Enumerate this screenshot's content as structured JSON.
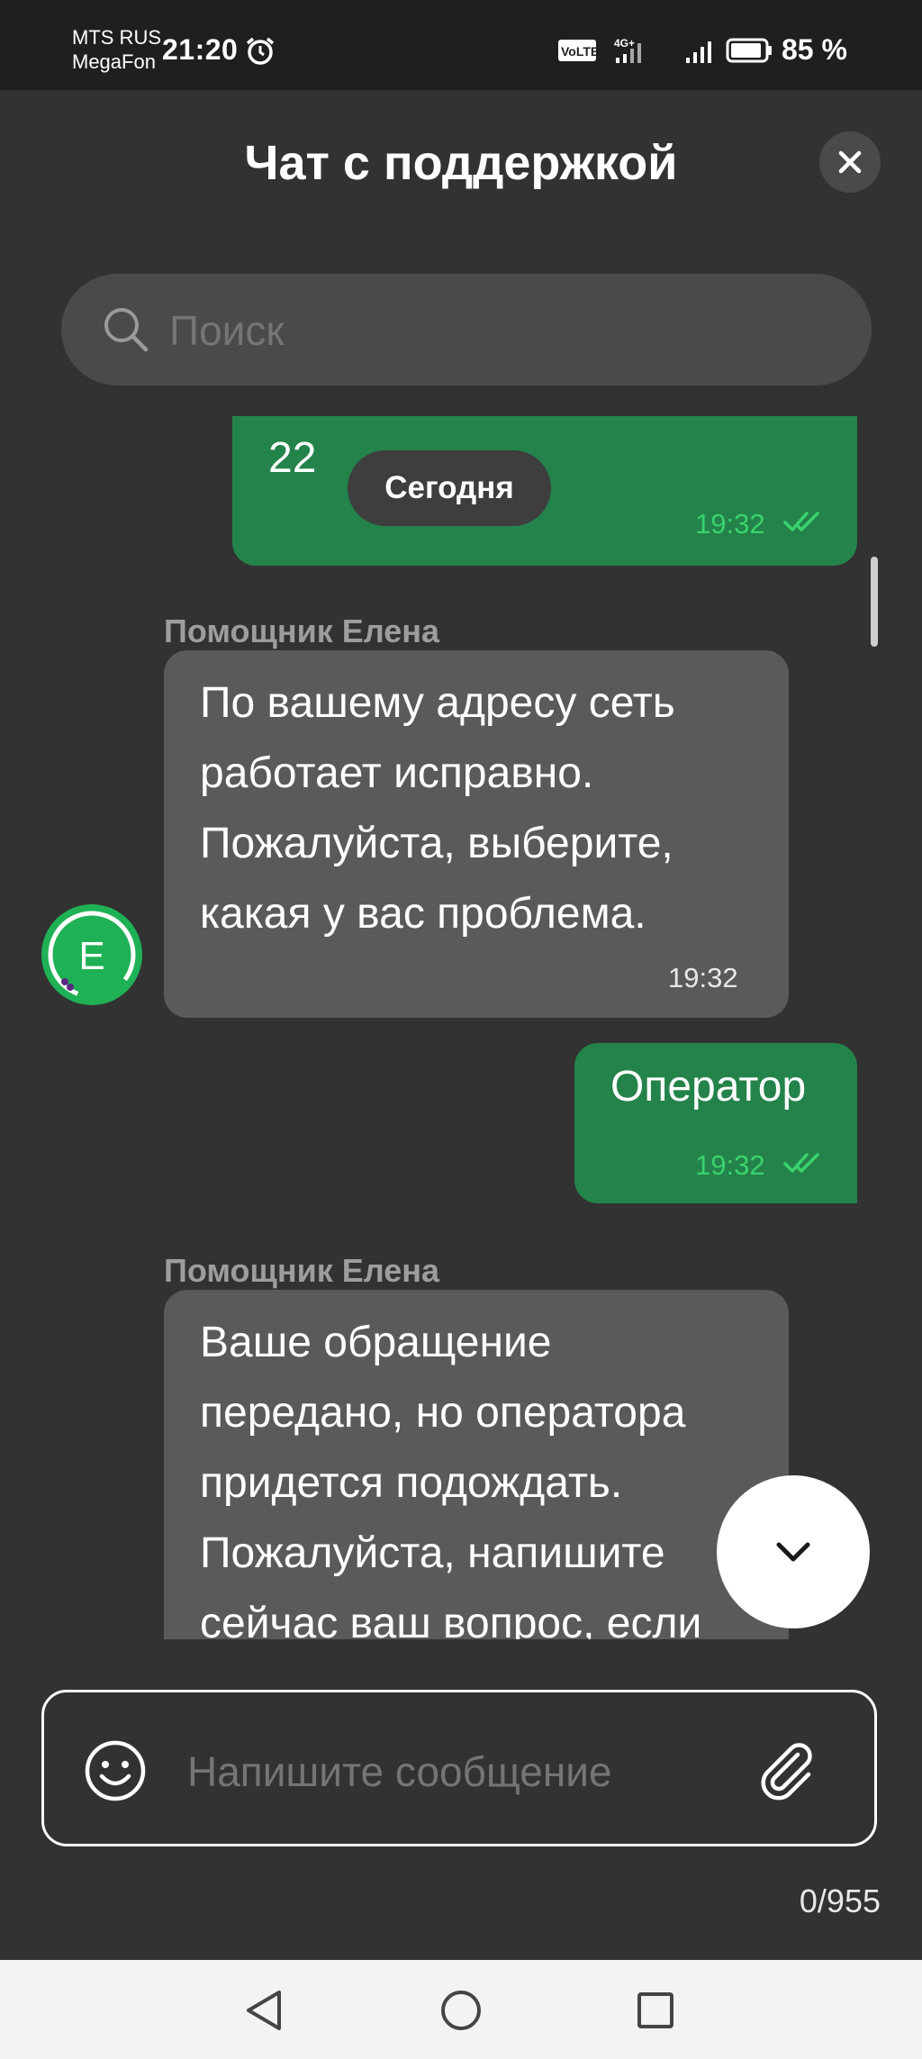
{
  "status_bar": {
    "carrier_1": "MTS RUS",
    "carrier_2": "MegaFon",
    "time": "21:20",
    "battery": "85 %",
    "icons": [
      "alarm-icon",
      "volte-icon",
      "4g-signal-icon",
      "signal-icon",
      "battery-icon"
    ]
  },
  "header": {
    "title": "Чат с поддержкой",
    "close_icon": "close-icon"
  },
  "search": {
    "placeholder": "Поиск",
    "value": ""
  },
  "date_chip": "Сегодня",
  "messages": [
    {
      "direction": "out",
      "text": "22",
      "time": "19:32",
      "status": "read"
    },
    {
      "direction": "in",
      "sender": "Помощник Елена",
      "lines": [
        "По вашему адресу сеть",
        "работает исправно.",
        "Пожалуйста, выберите,",
        "какая у вас проблема."
      ],
      "time": "19:32"
    },
    {
      "direction": "out",
      "text": "Оператор",
      "time": "19:32",
      "status": "read"
    },
    {
      "direction": "in",
      "sender": "Помощник Елена",
      "lines": [
        "Ваше обращение",
        "передано, но оператора",
        "придется подождать.",
        "Пожалуйста, напишите",
        "сейчас ваш вопрос, если"
      ]
    }
  ],
  "avatar_letter": "Е",
  "composer": {
    "placeholder": "Напишите сообщение",
    "value": "",
    "counter": "0/955"
  },
  "colors": {
    "background": "#323232",
    "outgoing_bubble": "#24834a",
    "incoming_bubble": "#5a5a5a",
    "accent_green": "#1fb155",
    "read_tick": "#3ad26e"
  },
  "navbar": {
    "icons": [
      "back-icon",
      "home-icon",
      "recents-icon"
    ]
  }
}
